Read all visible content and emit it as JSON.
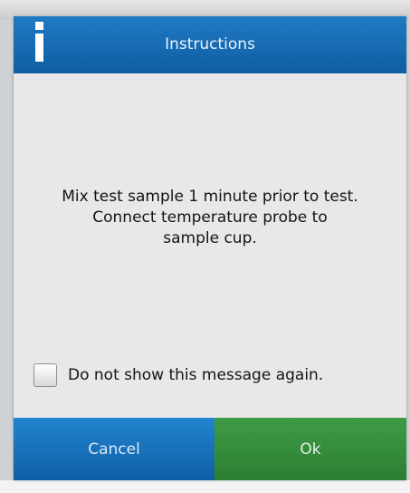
{
  "dialog": {
    "title": "Instructions",
    "message_lines": [
      "Mix test sample  1 minute prior to test.",
      "Connect temperature probe to",
      "sample cup."
    ],
    "dont_show_label": "Do not show this message again.",
    "dont_show_checked": false,
    "cancel_label": "Cancel",
    "ok_label": "Ok",
    "icon": "info-icon"
  },
  "colors": {
    "header": "#1669b0",
    "cancel_button": "#1a73bb",
    "ok_button": "#358c3c",
    "body": "#e8e8e8"
  }
}
